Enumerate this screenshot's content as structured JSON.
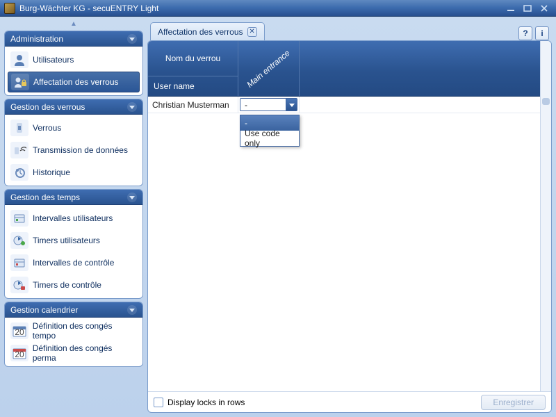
{
  "window": {
    "title": "Burg-Wächter KG - secuENTRY Light"
  },
  "sidebar": {
    "sections": [
      {
        "title": "Administration",
        "items": [
          {
            "label": "Utilisateurs",
            "icon": "user-icon"
          },
          {
            "label": "Affectation des verrous",
            "icon": "lock-assign-icon",
            "selected": true
          }
        ]
      },
      {
        "title": "Gestion des verrous",
        "items": [
          {
            "label": "Verrous",
            "icon": "lock-icon"
          },
          {
            "label": "Transmission de données",
            "icon": "transmit-icon"
          },
          {
            "label": "Historique",
            "icon": "history-icon"
          }
        ]
      },
      {
        "title": "Gestion des temps",
        "items": [
          {
            "label": "Intervalles utilisateurs",
            "icon": "interval-user-icon"
          },
          {
            "label": "Timers utilisateurs",
            "icon": "timer-user-icon"
          },
          {
            "label": "Intervalles de contrôle",
            "icon": "interval-control-icon"
          },
          {
            "label": "Timers de contrôle",
            "icon": "timer-control-icon"
          }
        ]
      },
      {
        "title": "Gestion calendrier",
        "items": [
          {
            "label": "Définition des congés tempo",
            "icon": "calendar-temp-icon"
          },
          {
            "label": "Définition des congés perma",
            "icon": "calendar-perm-icon"
          }
        ]
      }
    ]
  },
  "tab": {
    "title": "Affectation des verrous"
  },
  "grid": {
    "lock_name_header": "Nom du verrou",
    "user_name_header": "User name",
    "columns": [
      {
        "label": "Main entrance"
      }
    ],
    "rows": [
      {
        "user": "Christian  Musterman",
        "values": [
          "-"
        ]
      }
    ]
  },
  "dropdown": {
    "options": [
      "-",
      "Use code only"
    ],
    "selected_index": 0
  },
  "footer": {
    "display_locks_label": "Display locks in rows",
    "save_label": "Enregistrer"
  },
  "helpbar": {
    "help": "?",
    "info": "i"
  }
}
